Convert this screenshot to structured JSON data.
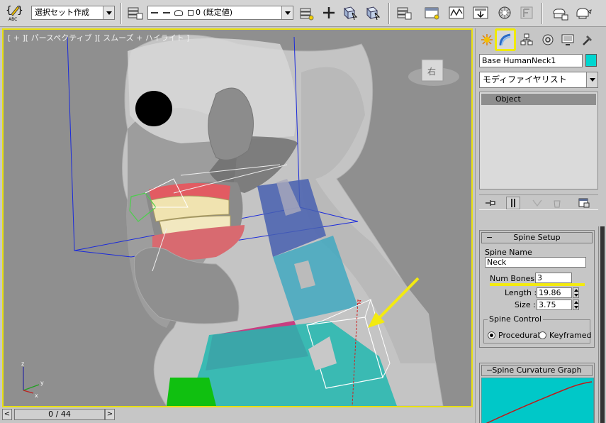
{
  "toolbar": {
    "selection_set": "選択セット作成",
    "layer": "0 (既定値)",
    "abc_label": "ABC"
  },
  "viewport": {
    "label": "[ + ][ パースペクティブ ][ スムーズ + ハイライト ]",
    "viewcube_label": "右",
    "axis_x": "x",
    "axis_y": "y",
    "axis_z": "z",
    "gizmo_axis": "z"
  },
  "timeline": {
    "frame": "0 / 44",
    "prev": "<",
    "next": ">"
  },
  "panel": {
    "object_name": "Base HumanNeck1",
    "object_color": "#00d6d0",
    "modifier_list": "モディファイヤリスト",
    "stack_items": [
      "Object"
    ],
    "spine_setup": {
      "title": "Spine Setup",
      "spine_name_label": "Spine Name",
      "spine_name_value": "Neck",
      "num_bones_label": "Num Bones :",
      "num_bones_value": "3",
      "length_label": "Length :",
      "length_value": "19.86",
      "size_label": "Size :",
      "size_value": "3.75",
      "spine_control_label": "Spine Control",
      "procedural_label": "Procedural",
      "keyframed_label": "Keyframed",
      "selected_control": "Procedural"
    },
    "curvature_graph": {
      "title": "Spine Curvature Graph"
    }
  },
  "colors": {
    "highlight_yellow": "#f0ea00",
    "graph_bg": "#00c8c8",
    "graph_curve": "#c01818"
  }
}
